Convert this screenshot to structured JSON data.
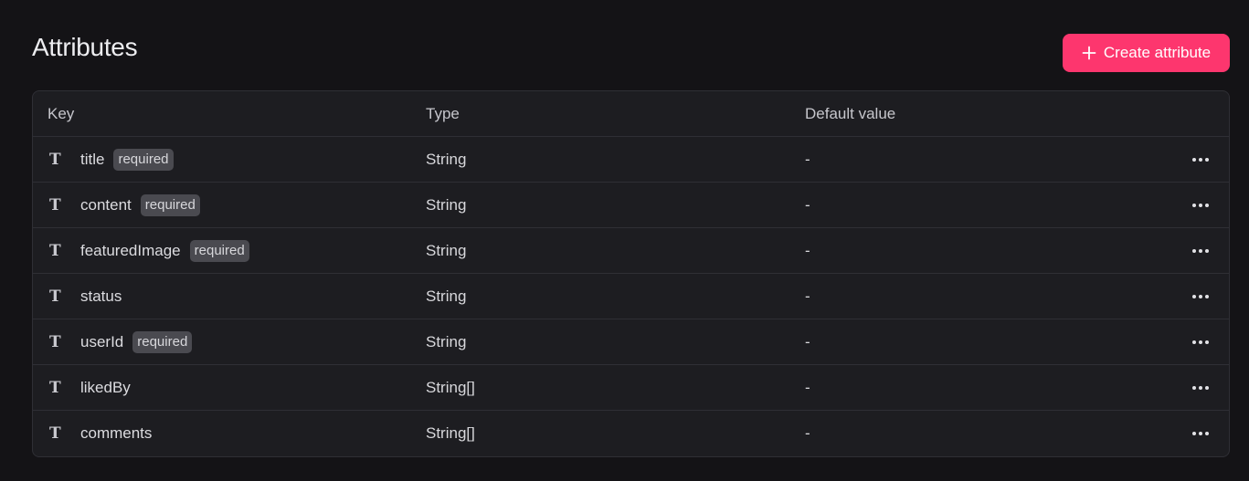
{
  "page": {
    "title": "Attributes",
    "create_button_label": "Create attribute"
  },
  "colors": {
    "accent": "#fd366e",
    "background": "#141316",
    "table_background": "#1d1d21"
  },
  "table": {
    "headers": {
      "key": "Key",
      "type": "Type",
      "default": "Default value"
    },
    "rows": [
      {
        "icon": "text-type-icon",
        "glyph": "T",
        "key": "title",
        "badge": "required",
        "type": "String",
        "default": "-"
      },
      {
        "icon": "text-type-icon",
        "glyph": "T",
        "key": "content",
        "badge": "required",
        "type": "String",
        "default": "-"
      },
      {
        "icon": "text-type-icon",
        "glyph": "T",
        "key": "featuredImage",
        "badge": "required",
        "type": "String",
        "default": "-"
      },
      {
        "icon": "text-type-icon",
        "glyph": "T",
        "key": "status",
        "badge": "",
        "type": "String",
        "default": "-"
      },
      {
        "icon": "text-type-icon",
        "glyph": "T",
        "key": "userId",
        "badge": "required",
        "type": "String",
        "default": "-"
      },
      {
        "icon": "text-type-icon",
        "glyph": "T",
        "key": "likedBy",
        "badge": "",
        "type": "String[]",
        "default": "-"
      },
      {
        "icon": "text-type-icon",
        "glyph": "T",
        "key": "comments",
        "badge": "",
        "type": "String[]",
        "default": "-"
      }
    ]
  }
}
